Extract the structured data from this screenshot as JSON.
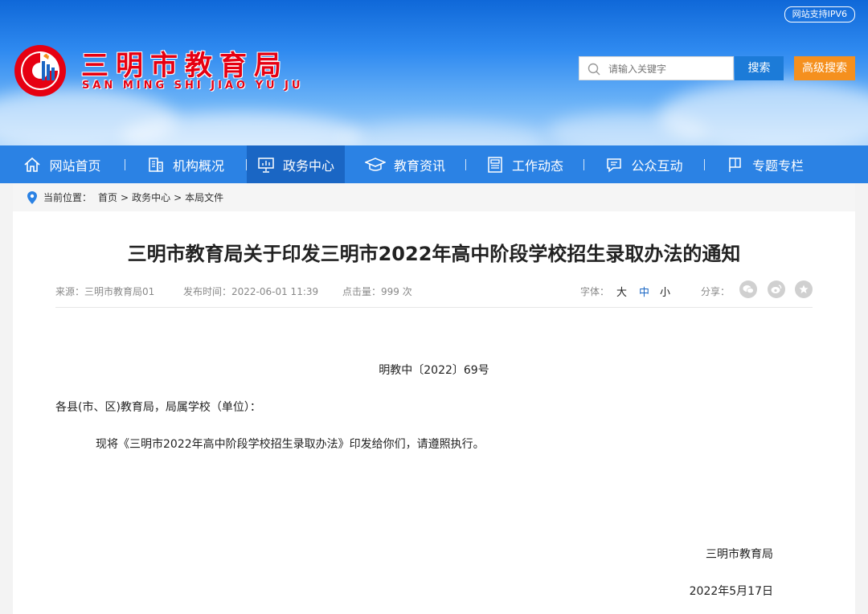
{
  "header": {
    "ipv6_badge": "网站支持IPV6",
    "logo_title": "三明市教育局",
    "logo_subtitle": "SAN MING SHI JIAO YU JU",
    "search_placeholder": "请输入关键字",
    "search_button": "搜索",
    "advanced_search_button": "高级搜索"
  },
  "nav": {
    "items": [
      {
        "label": "网站首页",
        "icon": "home-icon"
      },
      {
        "label": "机构概况",
        "icon": "building-icon"
      },
      {
        "label": "政务中心",
        "icon": "presentation-icon",
        "active": true
      },
      {
        "label": "教育资讯",
        "icon": "graduation-cap-icon"
      },
      {
        "label": "工作动态",
        "icon": "news-icon"
      },
      {
        "label": "公众互动",
        "icon": "chat-icon"
      },
      {
        "label": "专题专栏",
        "icon": "flag-icon"
      }
    ]
  },
  "breadcrumb": {
    "prefix": "当前位置：",
    "items": [
      "首页",
      "政务中心",
      "本局文件"
    ],
    "separator": ">"
  },
  "article": {
    "title": "三明市教育局关于印发三明市2022年高中阶段学校招生录取办法的通知",
    "source": "来源：三明市教育局01",
    "publish_time": "发布时间：2022-06-01 11:39",
    "clicks": "点击量：999 次",
    "font_label": "字体：",
    "font_sizes": [
      "大",
      "中",
      "小"
    ],
    "share_label": "分享：",
    "doc_number": "明教中〔2022〕69号",
    "salutation": "各县(市、区)教育局，局属学校（单位）：",
    "body": "现将《三明市2022年高中阶段学校招生录取办法》印发给你们，请遵照执行。",
    "signature": "三明市教育局",
    "date": "2022年5月17日"
  },
  "colors": {
    "nav_bg": "#2b82e4",
    "nav_active": "#1a66c4",
    "accent_orange": "#f5901e",
    "logo_red": "#e60012"
  }
}
